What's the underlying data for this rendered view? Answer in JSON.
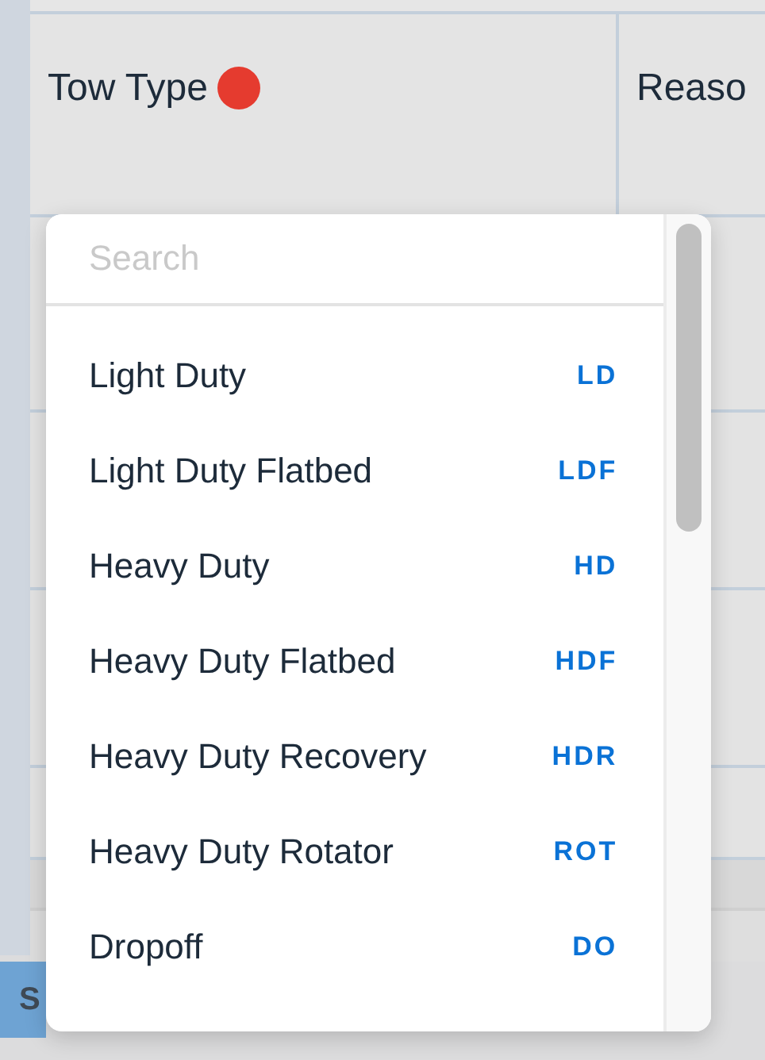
{
  "table": {
    "columns": [
      {
        "label": "Tow Type",
        "required": true
      },
      {
        "label": "Reaso",
        "required": false
      }
    ]
  },
  "button": {
    "label": "S"
  },
  "dropdown": {
    "search": {
      "placeholder": "Search"
    },
    "options": [
      {
        "label": "Light Duty",
        "code": "LD"
      },
      {
        "label": "Light Duty Flatbed",
        "code": "LDF"
      },
      {
        "label": "Heavy Duty",
        "code": "HD"
      },
      {
        "label": "Heavy Duty Flatbed",
        "code": "HDF"
      },
      {
        "label": "Heavy Duty Recovery",
        "code": "HDR"
      },
      {
        "label": "Heavy Duty Rotator",
        "code": "ROT"
      },
      {
        "label": "Dropoff",
        "code": "DO"
      }
    ]
  }
}
